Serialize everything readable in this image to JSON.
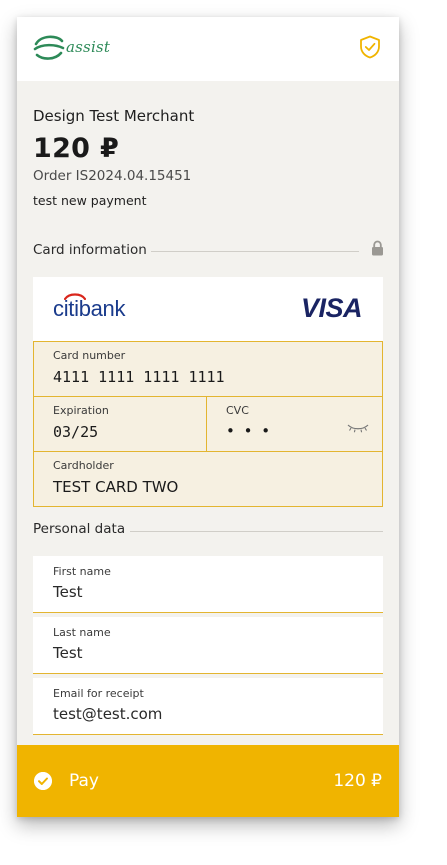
{
  "header": {
    "logo_text": "assist",
    "icons": {
      "logo": "assist-logo-icon",
      "shield": "shield-check-icon"
    }
  },
  "payment": {
    "merchant": "Design Test Merchant",
    "amount": "120 ₽",
    "order": "Order IS2024.04.15451",
    "description": "test new payment"
  },
  "card_section": {
    "title": "Card information",
    "lock_icon": "lock-icon",
    "bank_name": "citibank",
    "card_brand": "VISA",
    "fields": {
      "card_number_label": "Card number",
      "card_number_value": "4111 1111 1111 1111",
      "expiration_label": "Expiration",
      "expiration_value": "03/25",
      "cvc_label": "CVC",
      "cvc_value": "• • •",
      "cvc_toggle_icon": "eye-closed-icon",
      "cardholder_label": "Cardholder",
      "cardholder_value": "TEST CARD TWO"
    }
  },
  "personal_section": {
    "title": "Personal data",
    "first_name_label": "First name",
    "first_name_value": "Test",
    "last_name_label": "Last name",
    "last_name_value": "Test",
    "email_label": "Email for receipt",
    "email_value": "test@test.com"
  },
  "pay_button": {
    "label": "Pay",
    "amount": "120 ₽",
    "icon": "check-circle-icon"
  },
  "colors": {
    "accent": "#f0b400",
    "field_border": "#e3b530",
    "logo_green": "#2d8a58",
    "citi_blue": "#1a3b8c",
    "visa_blue": "#1a2463",
    "panel_bg": "#f3f2ee"
  }
}
